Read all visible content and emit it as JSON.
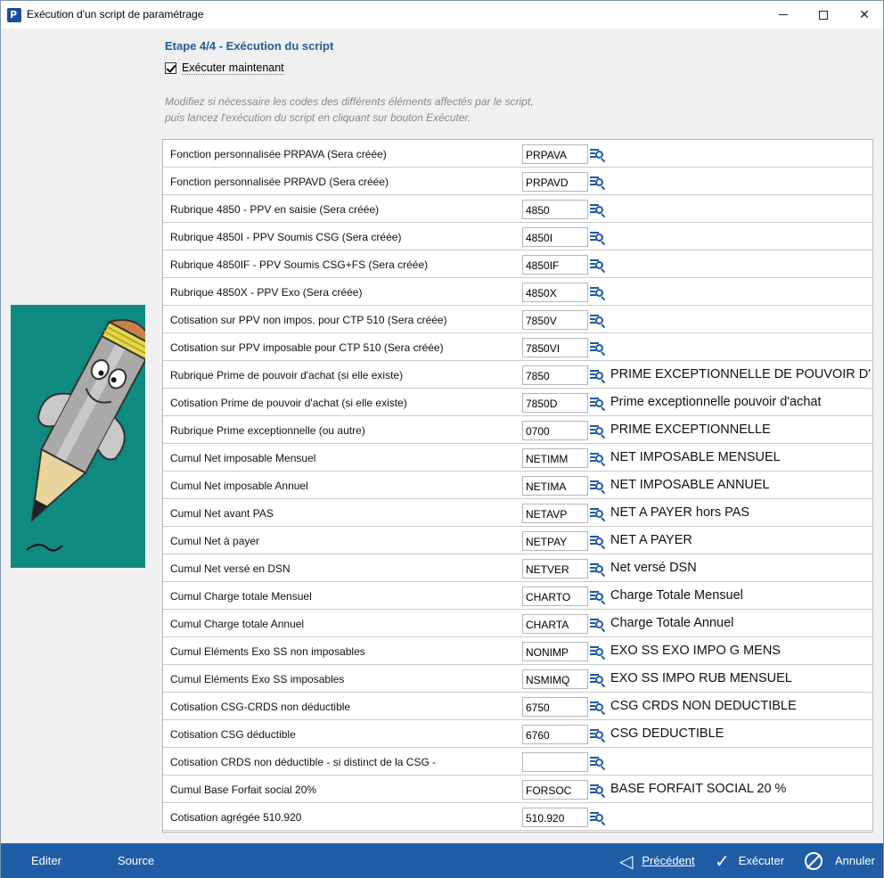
{
  "window": {
    "title": "Exécution d'un script de paramétrage"
  },
  "header": {
    "step_title": "Etape 4/4 - Exécution du script",
    "run_now_label": "Exécuter maintenant",
    "run_now_checked": true,
    "instructions_line1": "Modifiez si nécessaire les codes des différents éléments affectés par le script,",
    "instructions_line2": "puis lancez l'exécution du script en cliquant sur bouton Exécuter."
  },
  "rows": [
    {
      "label": "Fonction personnalisée PRPAVA (Sera créée)",
      "code": "PRPAVA",
      "desc": ""
    },
    {
      "label": "Fonction personnalisée PRPAVD (Sera créée)",
      "code": "PRPAVD",
      "desc": ""
    },
    {
      "label": "Rubrique 4850 - PPV en saisie (Sera créée)",
      "code": "4850",
      "desc": ""
    },
    {
      "label": "Rubrique 4850I - PPV Soumis CSG (Sera créée)",
      "code": "4850I",
      "desc": ""
    },
    {
      "label": "Rubrique 4850IF - PPV Soumis CSG+FS (Sera créée)",
      "code": "4850IF",
      "desc": ""
    },
    {
      "label": "Rubrique 4850X - PPV Exo (Sera créée)",
      "code": "4850X",
      "desc": ""
    },
    {
      "label": "Cotisation sur PPV non impos. pour CTP 510 (Sera créée)",
      "code": "7850V",
      "desc": ""
    },
    {
      "label": "Cotisation sur PPV imposable pour CTP 510 (Sera créée)",
      "code": "7850VI",
      "desc": ""
    },
    {
      "label": "Rubrique Prime de pouvoir d'achat (si elle existe)",
      "code": "7850",
      "desc": "PRIME EXCEPTIONNELLE DE POUVOIR D'AC"
    },
    {
      "label": "Cotisation Prime de pouvoir d'achat (si elle existe)",
      "code": "7850D",
      "desc": "Prime exceptionnelle pouvoir d'achat"
    },
    {
      "label": "Rubrique Prime exceptionnelle (ou autre)",
      "code": "0700",
      "desc": "PRIME EXCEPTIONNELLE"
    },
    {
      "label": "Cumul Net imposable Mensuel",
      "code": "NETIMM",
      "desc": "NET IMPOSABLE MENSUEL"
    },
    {
      "label": "Cumul Net imposable Annuel",
      "code": "NETIMA",
      "desc": "NET IMPOSABLE ANNUEL"
    },
    {
      "label": "Cumul Net avant PAS",
      "code": "NETAVP",
      "desc": "NET A PAYER hors PAS"
    },
    {
      "label": "Cumul Net à payer",
      "code": "NETPAY",
      "desc": "NET A PAYER"
    },
    {
      "label": "Cumul Net versé en DSN",
      "code": "NETVER",
      "desc": "Net versé DSN"
    },
    {
      "label": "Cumul Charge totale Mensuel",
      "code": "CHARTO",
      "desc": "Charge Totale Mensuel"
    },
    {
      "label": "Cumul Charge totale Annuel",
      "code": "CHARTA",
      "desc": "Charge Totale Annuel"
    },
    {
      "label": "Cumul Eléments Exo SS non imposables",
      "code": "NONIMP",
      "desc": "EXO SS EXO IMPO G MENS"
    },
    {
      "label": "Cumul Eléments Exo SS imposables",
      "code": "NSMIMQ",
      "desc": "EXO SS IMPO RUB MENSUEL"
    },
    {
      "label": "Cotisation CSG-CRDS non déductible",
      "code": "6750",
      "desc": "CSG CRDS NON DEDUCTIBLE"
    },
    {
      "label": "Cotisation CSG déductible",
      "code": "6760",
      "desc": "CSG DEDUCTIBLE"
    },
    {
      "label": "Cotisation CRDS non déductible - si distinct de la CSG -",
      "code": "",
      "desc": ""
    },
    {
      "label": "Cumul Base Forfait social 20%",
      "code": "FORSOC",
      "desc": "BASE FORFAIT SOCIAL 20 %"
    },
    {
      "label": "Cotisation agrégée 510.920",
      "code": "510.920",
      "desc": ""
    }
  ],
  "footer": {
    "edit_label": "Editer",
    "source_label": "Source",
    "previous_label": "Précédent",
    "execute_label": "Exécuter",
    "cancel_label": "Annuler"
  },
  "colors": {
    "accent": "#1f5ea6",
    "step_title": "#1f5c9e",
    "picture_background": "#0f8a80"
  },
  "icons": {
    "app": "app-logo-icon",
    "lookup": "lookup-list-search-icon",
    "previous": "triangle-left-icon",
    "execute": "checkmark-icon",
    "cancel": "prohibited-circle-icon"
  }
}
